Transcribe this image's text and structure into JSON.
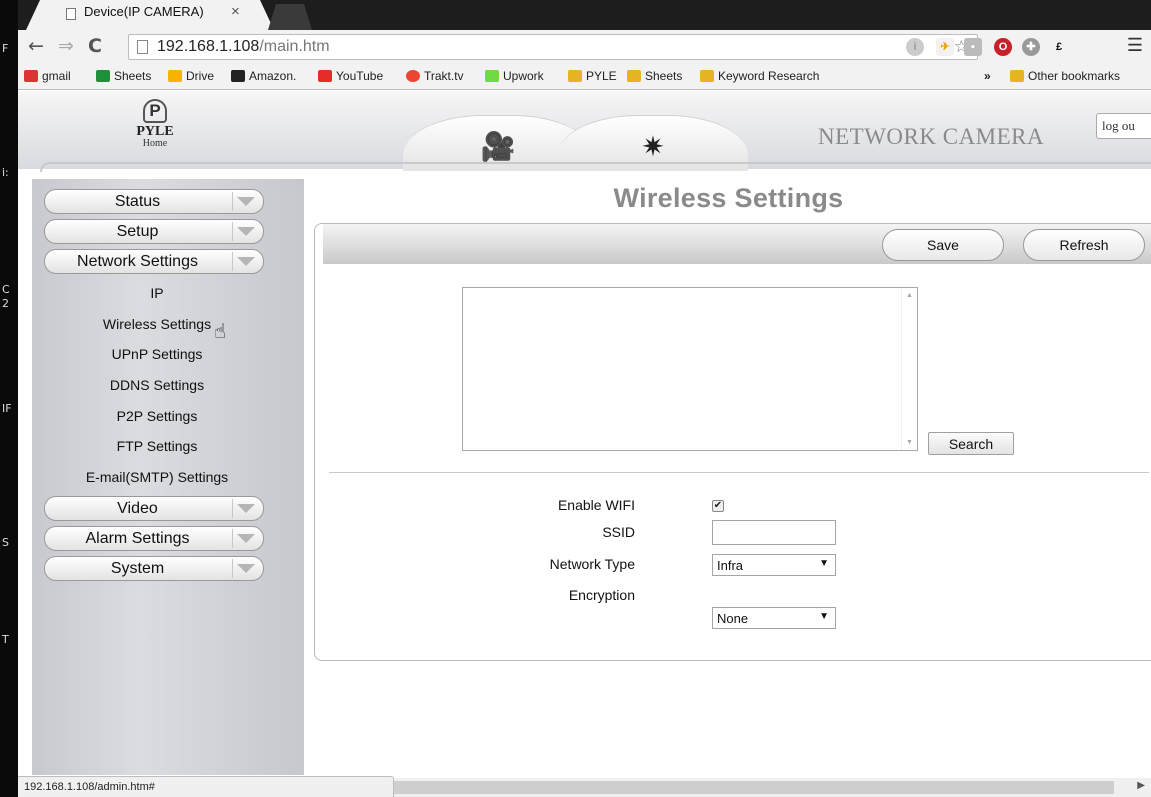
{
  "desktop": {
    "edge_letters": [
      "F",
      "i:",
      "C",
      "2",
      "IF",
      "S",
      "T"
    ]
  },
  "browser": {
    "tab_title": "Device(IP CAMERA)",
    "tab_close": "×",
    "url_host": "192.168.1.108",
    "url_path": "/main.htm",
    "bookmarks": [
      "gmail",
      "Sheets",
      "Drive",
      "Amazon.",
      "YouTube",
      "Trakt.tv",
      "Upwork",
      "PYLE",
      "Sheets",
      "Keyword Research"
    ],
    "bookmarks_overflow": "»",
    "other_bookmarks": "Other bookmarks",
    "status_url": "192.168.1.108/admin.htm#"
  },
  "camera": {
    "logo_name": "PYLE",
    "logo_sub": "Home",
    "brand": "NETWORK CAMERA",
    "logout": "log ou",
    "header_tabs": [
      {
        "icon": "video-camera-icon"
      },
      {
        "icon": "gear-icon"
      }
    ],
    "menu": {
      "status": "Status",
      "setup": "Setup",
      "network": "Network Settings",
      "sub": [
        "IP",
        "Wireless Settings",
        "UPnP Settings",
        "DDNS Settings",
        "P2P Settings",
        "FTP Settings",
        "E-mail(SMTP) Settings"
      ],
      "video": "Video",
      "alarm": "Alarm Settings",
      "system": "System"
    },
    "page_title": "Wireless Settings",
    "actions": {
      "save": "Save",
      "refresh": "Refresh",
      "search": "Search"
    },
    "form": {
      "enable_wifi_label": "Enable WIFI",
      "enable_wifi_checked": "✔",
      "ssid_label": "SSID",
      "ssid_value": "",
      "network_type_label": "Network Type",
      "network_type_value": "Infra",
      "encryption_label": "Encryption",
      "encryption_value": "None"
    }
  }
}
